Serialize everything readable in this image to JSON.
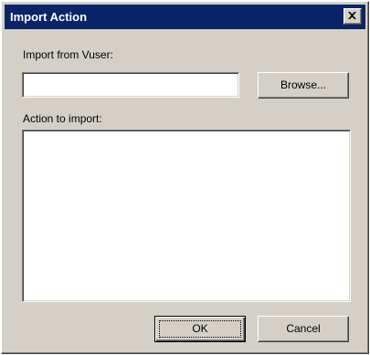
{
  "window": {
    "title": "Import Action",
    "close_icon": "close-icon"
  },
  "form": {
    "import_from_label": "Import from Vuser:",
    "import_from_value": "",
    "browse_label": "Browse...",
    "action_label": "Action to import:",
    "actions": []
  },
  "buttons": {
    "ok_label": "OK",
    "cancel_label": "Cancel"
  }
}
